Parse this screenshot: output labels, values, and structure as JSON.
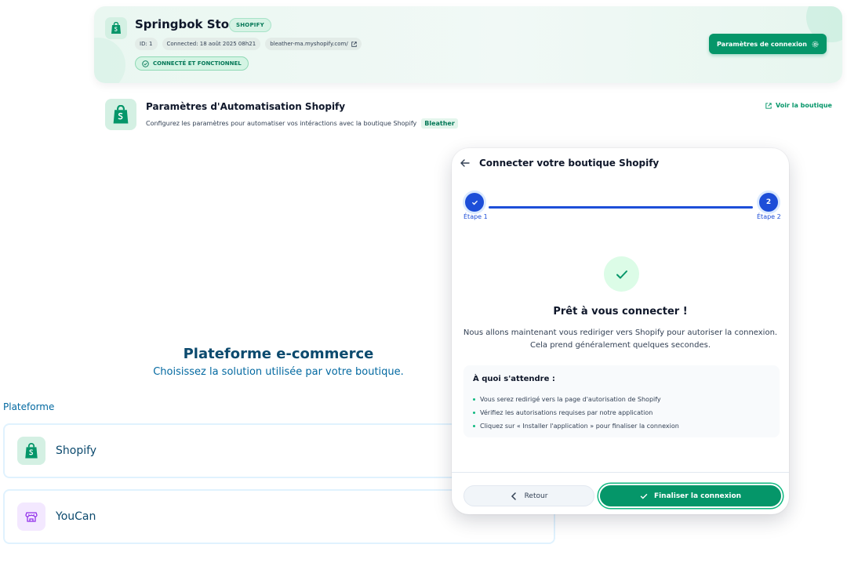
{
  "colors": {
    "accent": "#059669",
    "primary_blue": "#1d4ed8",
    "heading_blue": "#0c4a6e"
  },
  "store": {
    "name": "Springbok Store",
    "platform_badge": "SHOPIFY",
    "meta": {
      "id": "ID: 1",
      "connected": "Connected: 18 août 2025 08h21",
      "domain": "bleather-ma.myshopify.com/"
    },
    "status": "CONNECTÉ ET FONCTIONNEL",
    "connection_settings_label": "Paramètres de connexion"
  },
  "automation": {
    "title": "Paramètres d'Automatisation Shopify",
    "subtitle": "Configurez les paramètres pour automatiser vos intéractions avec la boutique Shopify",
    "brand": "Bleather",
    "view_shop_label": "Voir la boutique"
  },
  "platform_section": {
    "title": "Plateforme e-commerce",
    "subtitle": "Choisissez la solution utilisée par votre boutique.",
    "field_label": "Plateforme",
    "options": [
      {
        "label": "Shopify",
        "icon": "shopify-bag-icon"
      },
      {
        "label": "YouCan",
        "icon": "storefront-icon"
      }
    ]
  },
  "modal": {
    "title": "Connecter votre boutique Shopify",
    "steps": [
      {
        "label": "Étape 1",
        "marker": ""
      },
      {
        "label": "Étape 2",
        "marker": "2"
      }
    ],
    "ready_title": "Prêt à vous connecter !",
    "ready_desc_line1": "Nous allons maintenant vous rediriger vers Shopify pour autoriser la connexion.",
    "ready_desc_line2": "Cela prend généralement quelques secondes.",
    "expect_title": "À quoi s'attendre :",
    "expect_items": [
      "Vous serez redirigé vers la page d'autorisation de Shopify",
      "Vérifiez les autorisations requises par notre application",
      "Cliquez sur « Installer l'application » pour finaliser la connexion"
    ],
    "back_label": "Retour",
    "finish_label": "Finaliser la connexion"
  }
}
